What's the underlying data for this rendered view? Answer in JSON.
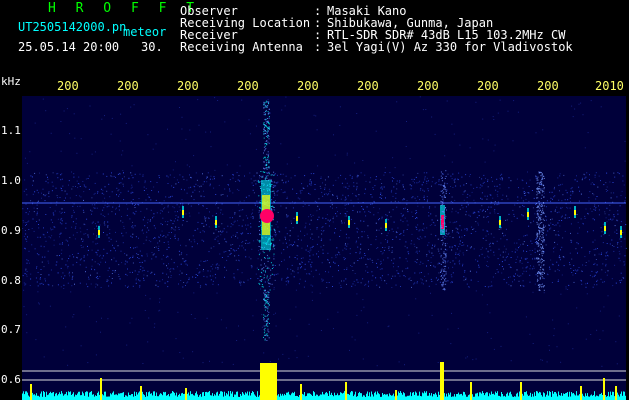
{
  "header": {
    "title": "H R O F F T",
    "filename": "UT2505142000.pn",
    "type_label": "meteor",
    "datetime": "25.05.14 20:00",
    "count": "30."
  },
  "info": {
    "rows": [
      {
        "label": "Observer",
        "sep": ":",
        "value": "Masaki Kano"
      },
      {
        "label": "Receiving Location",
        "sep": ":",
        "value": "Shibukawa, Gunma, Japan"
      },
      {
        "label": "Receiver",
        "sep": ":",
        "value": "RTL-SDR SDR# 43dB L15 103.2MHz CW"
      },
      {
        "label": "Receiving Antenna",
        "sep": ":",
        "value": "3el Yagi(V) Az 330 for Vladivostok"
      }
    ]
  },
  "axis": {
    "y_unit": "kHz",
    "y_ticks": [
      "1.1",
      "1.0",
      "0.9",
      "0.8",
      "0.7",
      "0.6"
    ],
    "x_ticks": [
      "200",
      "200",
      "200",
      "200",
      "200",
      "200",
      "200",
      "200",
      "200",
      "2010"
    ]
  },
  "colors": {
    "background": "#00003a",
    "noise_blue": "#3355ff",
    "cyan": "#00ffff",
    "yellow": "#ffff00",
    "magenta": "#ff0066",
    "green": "#00ff00"
  }
}
